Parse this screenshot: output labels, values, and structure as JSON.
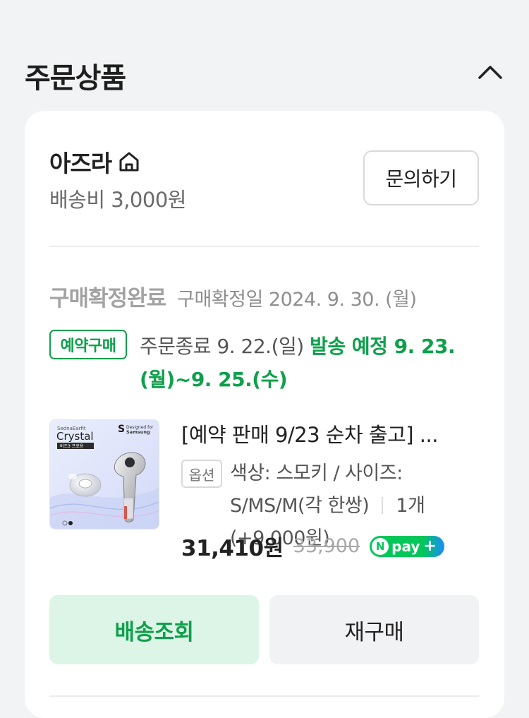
{
  "section": {
    "title": "주문상품"
  },
  "store": {
    "name": "아즈라",
    "shipping_fee": "배송비 3,000원",
    "inquiry_label": "문의하기"
  },
  "order": {
    "status": "구매확정완료",
    "confirm_date": "구매확정일 2024. 9. 30. (월)",
    "reserve_badge": "예약구매",
    "order_end": "주문종료 9. 22.(일)",
    "ship_schedule": "발송 예정 9. 23.(월)~9. 25.(수)"
  },
  "product": {
    "title": "[예약 판매 9/23 순차 출고] ...",
    "option_badge": "옵션",
    "option_text": "색상: 스모키 / 사이즈: S/MS/M(각 한쌍)",
    "quantity": "1개 (+9,000원)",
    "sale_price": "31,410원",
    "original_price": "33,900",
    "thumbnail": {
      "brand_line": "SednaEarfit",
      "product_line": "Crystal",
      "sub_line": "버즈3 프로용",
      "partner_line1": "Designed for",
      "partner_line2": "Samsung"
    }
  },
  "npay": {
    "n": "N",
    "label": "pay",
    "plus": "+"
  },
  "actions": {
    "track_label": "배송조회",
    "rebuy_label": "재구매"
  },
  "colors": {
    "accent_green": "#0ea04b",
    "npay_green": "#03c75a",
    "card_bg": "#ffffff",
    "page_bg": "#f2f3f5"
  }
}
